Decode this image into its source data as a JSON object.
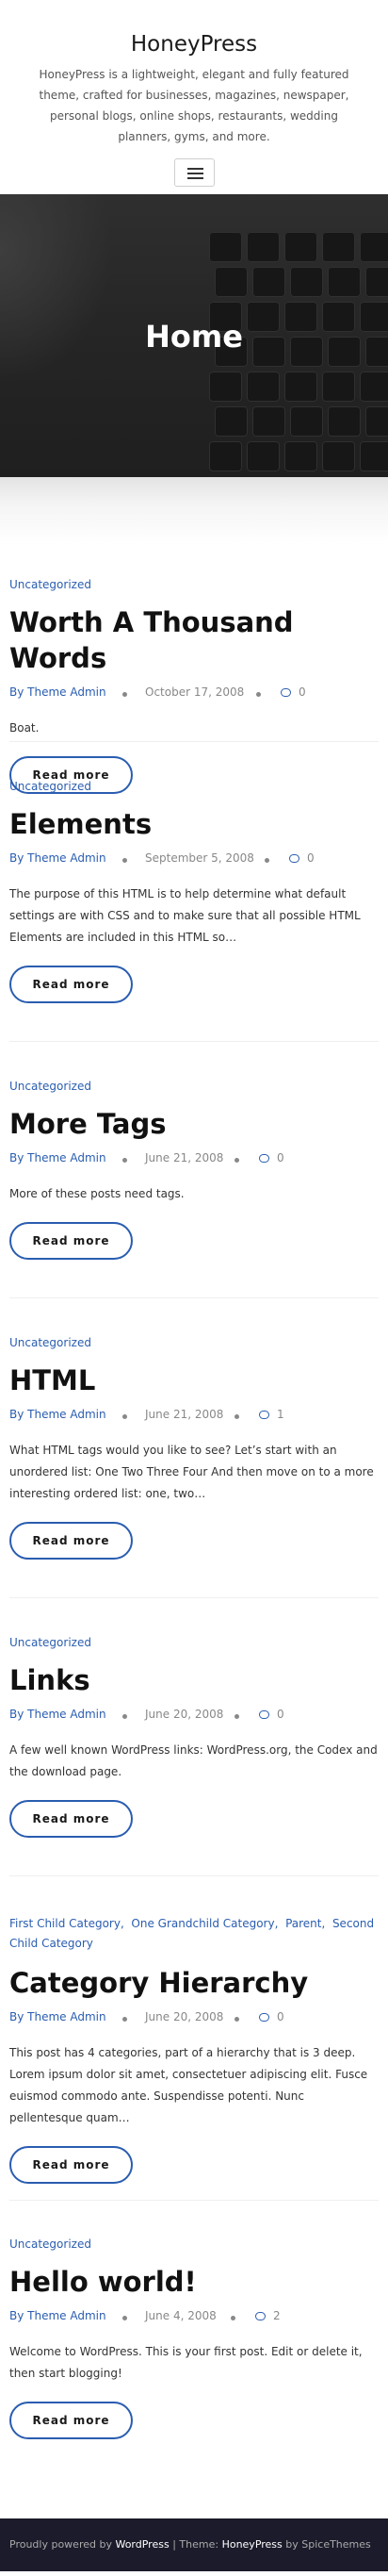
{
  "site": {
    "title": "HoneyPress",
    "description": "HoneyPress is a lightweight, elegant and fully featured theme, crafted for businesses, magazines, newspaper, personal blogs, online shops, restaurants, wedding planners, gyms, and more.",
    "menu_icon": "hamburger-icon"
  },
  "hero": {
    "title": "Home"
  },
  "posts": [
    {
      "categories": [
        "Uncategorized"
      ],
      "title": "Worth A Thousand Words",
      "author": "By Theme Admin",
      "date": "October 17, 2008",
      "comments": "0",
      "excerpt": "Boat.",
      "read_more": "Read more"
    },
    {
      "categories": [
        "Uncategorized"
      ],
      "title": "Elements",
      "author": "By Theme Admin",
      "date": "September 5, 2008",
      "comments": "0",
      "excerpt": "The purpose of this HTML is to help determine what default settings are with CSS and to make sure that all possible HTML Elements are included in this HTML so…",
      "read_more": "Read more"
    },
    {
      "categories": [
        "Uncategorized"
      ],
      "title": "More Tags",
      "author": "By Theme Admin",
      "date": "June 21, 2008",
      "comments": "0",
      "excerpt": "More of these posts need tags.",
      "read_more": "Read more"
    },
    {
      "categories": [
        "Uncategorized"
      ],
      "title": "HTML",
      "author": "By Theme Admin",
      "date": "June 21, 2008",
      "comments": "1",
      "excerpt": "What HTML tags would you like to see? Let’s start with an unordered list: One Two Three Four And then move on to a more interesting ordered list: one, two…",
      "read_more": "Read more"
    },
    {
      "categories": [
        "Uncategorized"
      ],
      "title": "Links",
      "author": "By Theme Admin",
      "date": "June 20, 2008",
      "comments": "0",
      "excerpt": "A few well known WordPress links: WordPress.org, the Codex and the download page.",
      "read_more": "Read more"
    },
    {
      "categories": [
        "First Child Category",
        "One Grandchild Category",
        "Parent",
        "Second Child Category"
      ],
      "title": "Category Hierarchy",
      "author": "By Theme Admin",
      "date": "June 20, 2008",
      "comments": "0",
      "excerpt": "This post has 4 categories, part of a hierarchy that is 3 deep. Lorem ipsum dolor sit amet, consectetuer adipiscing elit. Fusce euismod commodo ante. Suspendisse potenti. Nunc pellentesque quam…",
      "read_more": "Read more"
    },
    {
      "categories": [
        "Uncategorized"
      ],
      "title": "Hello world!",
      "author": "By Theme Admin",
      "date": "June 4, 2008",
      "comments": "2",
      "excerpt": "Welcome to WordPress. This is your first post. Edit or delete it, then start blogging!",
      "read_more": "Read more"
    }
  ],
  "footer": {
    "prefix": "Proudly powered by",
    "wordpress": "WordPress",
    "separator": "| Theme:",
    "theme": "HoneyPress",
    "by": "by SpiceThemes"
  },
  "colors": {
    "accent": "#2a5db0",
    "footer_bg": "#1b1b2b",
    "hero_bg": "#262626"
  }
}
